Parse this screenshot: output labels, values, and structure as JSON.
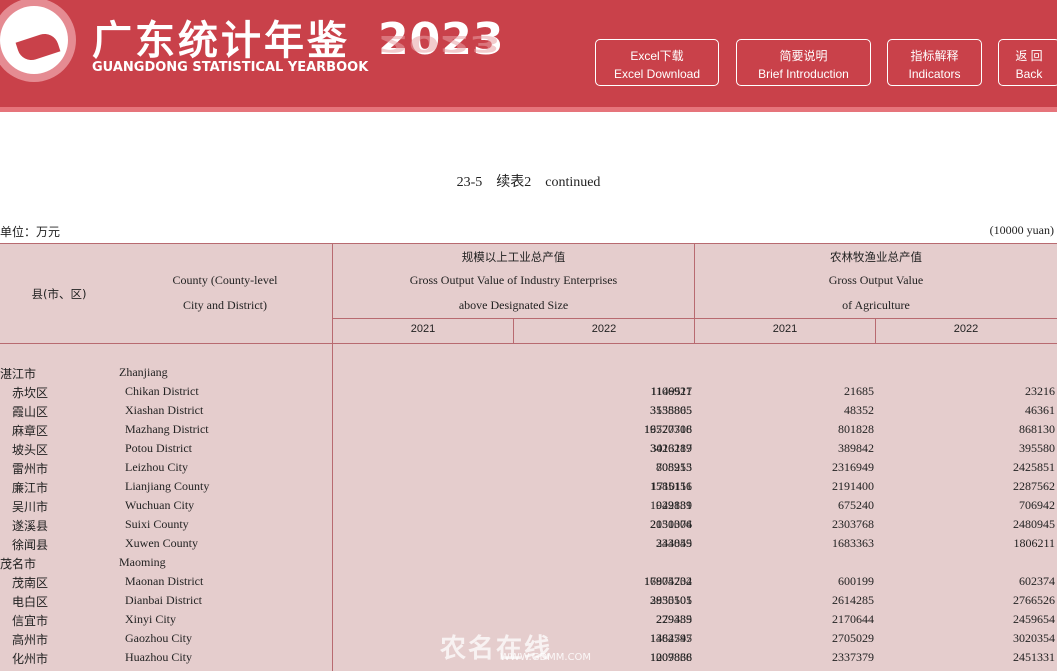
{
  "header": {
    "title_cn": "广东统计年鉴",
    "title_en": "GUANGDONG STATISTICAL YEARBOOK",
    "year": "2023",
    "buttons": [
      {
        "cn": "Excel下载",
        "en": "Excel Download"
      },
      {
        "cn": "简要说明",
        "en": "Brief Introduction"
      },
      {
        "cn": "指标解释",
        "en": "Indicators"
      },
      {
        "cn": "返 回",
        "en": "Back"
      }
    ]
  },
  "table": {
    "title": "23-5    续表2    continued",
    "unit_cn": "单位：万元",
    "unit_en": "(10000 yuan)",
    "headers": {
      "county_cn": "县(市、区)",
      "county_en_1": "County (County-level",
      "county_en_2": "City and District)",
      "industry_cn": "规模以上工业总产值",
      "industry_en_1": "Gross Output Value of Industry Enterprises",
      "industry_en_2": "above Designated Size",
      "agri_cn": "农林牧渔业总产值",
      "agri_en_1": "Gross Output Value",
      "agri_en_2": "of Agriculture",
      "years": [
        "2021",
        "2022",
        "2021",
        "2022"
      ]
    },
    "rows": [
      {
        "cn": "湛江市",
        "en": "Zhanjiang",
        "group": true,
        "v": [
          "",
          "",
          "",
          ""
        ]
      },
      {
        "cn": "赤坎区",
        "en": "Chikan District",
        "group": false,
        "v": [
          "1106927",
          "1149511",
          "21685",
          "23216"
        ]
      },
      {
        "cn": "霞山区",
        "en": "Xiashan District",
        "group": false,
        "v": [
          "3135865",
          "3558805",
          "48352",
          "46361"
        ]
      },
      {
        "cn": "麻章区",
        "en": "Mazhang District",
        "group": false,
        "v": [
          "16520708",
          "19777316",
          "801828",
          "868130"
        ]
      },
      {
        "cn": "坡头区",
        "en": "Potou District",
        "group": false,
        "v": [
          "3013119",
          "3426287",
          "389842",
          "395580"
        ]
      },
      {
        "cn": "雷州市",
        "en": "Leizhou City",
        "group": false,
        "v": [
          "705913",
          "808255",
          "2316949",
          "2425851"
        ]
      },
      {
        "cn": "廉江市",
        "en": "Lianjiang County",
        "group": false,
        "v": [
          "1710111",
          "1585156",
          "2191400",
          "2287562"
        ]
      },
      {
        "cn": "吴川市",
        "en": "Wuchuan City",
        "group": false,
        "v": [
          "1029131",
          "942889",
          "675240",
          "706942"
        ]
      },
      {
        "cn": "遂溪县",
        "en": "Suixi County",
        "group": false,
        "v": [
          "2051376",
          "2130004",
          "2303768",
          "2480945"
        ]
      },
      {
        "cn": "徐闻县",
        "en": "Xuwen County",
        "group": false,
        "v": [
          "244849",
          "333055",
          "1683363",
          "1806211"
        ]
      },
      {
        "cn": "茂名市",
        "en": "Maoming",
        "group": true,
        "v": [
          "",
          "",
          "",
          ""
        ]
      },
      {
        "cn": "茂南区",
        "en": "Maonan  District",
        "group": false,
        "v": [
          "16804234",
          "17975702",
          "600199",
          "602374"
        ]
      },
      {
        "cn": "电白区",
        "en": "Dianbai  District",
        "group": false,
        "v": [
          "2935501",
          "3850105",
          "2614285",
          "2766526"
        ]
      },
      {
        "cn": "信宜市",
        "en": "Xinyi City",
        "group": false,
        "v": [
          "229339",
          "279485",
          "2170644",
          "2459654"
        ]
      },
      {
        "cn": "高州市",
        "en": "Gaozhou City",
        "group": false,
        "v": [
          "1384747",
          "1462595",
          "2705029",
          "3020354"
        ]
      },
      {
        "cn": "化州市",
        "en": "Huazhou City",
        "group": false,
        "v": [
          "1009868",
          "1207836",
          "2337379",
          "2451331"
        ]
      }
    ]
  },
  "watermark": {
    "text": "农名在线",
    "sub": "WWW.GDMM.COM"
  }
}
